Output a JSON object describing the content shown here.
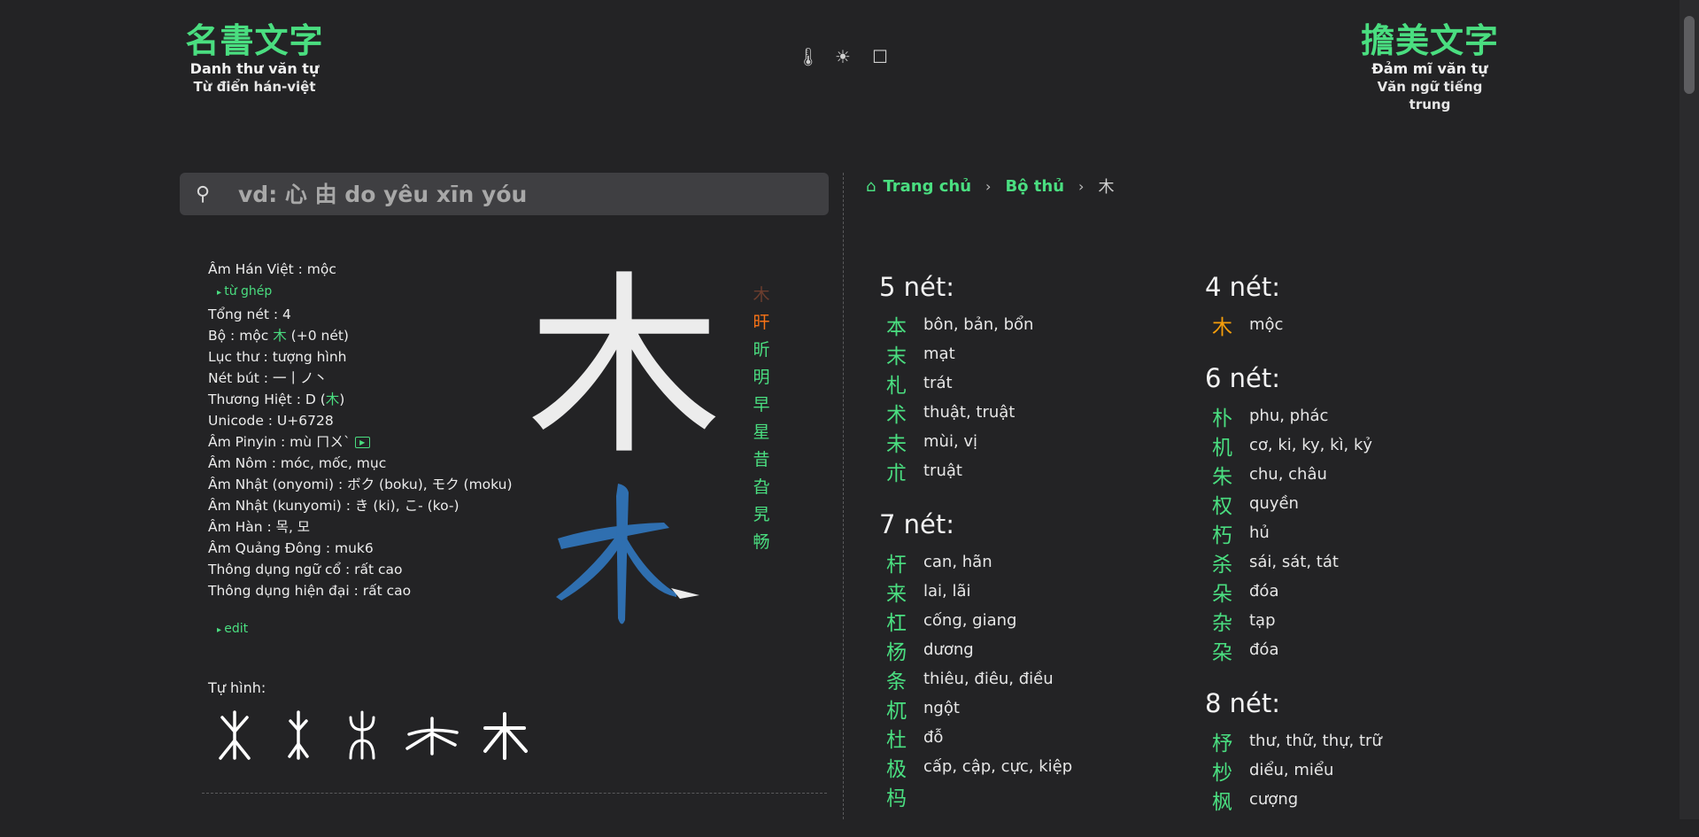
{
  "header": {
    "left": {
      "logo": "名書文字",
      "sub1": "Danh thư văn tự",
      "sub2": "Từ điển hán-việt"
    },
    "right": {
      "logo": "擔美文字",
      "sub1": "Đảm mĩ văn tự",
      "sub2": "Văn ngữ tiếng trung"
    },
    "icons": {
      "thermometer": "🌡",
      "sun": "☀",
      "square": "☐"
    }
  },
  "search": {
    "placeholder": "vd: 心 由 do yêu xīn yóu",
    "icon": "⚲"
  },
  "info": {
    "am_han_viet": "Âm Hán Việt : mộc",
    "tu_ghep": "từ ghép",
    "tong_net": "Tổng nét : 4",
    "bo_prefix": "Bộ : mộc ",
    "bo_char": "木",
    "bo_suffix": " (+0 nét)",
    "luc_thu": "Lục thư : tượng hình",
    "net_but": "Nét bút : 一丨ノ丶",
    "thuong_hiet_prefix": "Thương Hiệt : D (",
    "thuong_hiet_char": "木",
    "thuong_hiet_suffix": ")",
    "unicode": "Unicode : U+6728",
    "am_pinyin": "Âm Pinyin : mù ㄇㄨˋ",
    "play": "▶",
    "am_nom": "Âm Nôm : móc, mốc, mục",
    "am_nhat_on": "Âm Nhật (onyomi) : ボク (boku), モク (moku)",
    "am_nhat_kun": "Âm Nhật (kunyomi) : き (ki), こ- (ko-)",
    "am_han": "Âm Hàn : 목, 모",
    "am_quang_dong": "Âm Quảng Đông : muk6",
    "thong_dung_co": "Thông dụng ngữ cổ : rất cao",
    "thong_dung_hien": "Thông dụng hiện đại : rất cao",
    "edit": "edit",
    "tu_hinh": "Tự hình:"
  },
  "main_char": "木",
  "related": [
    "木",
    "旰",
    "昕",
    "明",
    "早",
    "星",
    "昔",
    "旮",
    "旯",
    "畅"
  ],
  "breadcrumb": {
    "home": "Trang chủ",
    "section": "Bộ thủ",
    "current": "木"
  },
  "groups_left": [
    {
      "title": "5 nét:",
      "items": [
        {
          "char": "本",
          "reading": "bôn, bản, bổn"
        },
        {
          "char": "末",
          "reading": "mạt"
        },
        {
          "char": "札",
          "reading": "trát"
        },
        {
          "char": "术",
          "reading": "thuật, truật"
        },
        {
          "char": "未",
          "reading": "mùi, vị"
        },
        {
          "char": "朮",
          "reading": "truật"
        }
      ]
    },
    {
      "title": "7 nét:",
      "items": [
        {
          "char": "杆",
          "reading": "can, hãn"
        },
        {
          "char": "来",
          "reading": "lai, lãi"
        },
        {
          "char": "杠",
          "reading": "cống, giang"
        },
        {
          "char": "杨",
          "reading": "dương"
        },
        {
          "char": "条",
          "reading": "thiêu, điêu, điều"
        },
        {
          "char": "杌",
          "reading": "ngột"
        },
        {
          "char": "杜",
          "reading": "đỗ"
        },
        {
          "char": "极",
          "reading": "cấp, cập, cực, kiệp"
        },
        {
          "char": "杩",
          "reading": ""
        }
      ]
    }
  ],
  "groups_right": [
    {
      "title": "4 nét:",
      "items": [
        {
          "char": "木",
          "reading": "mộc",
          "highlight": true
        }
      ]
    },
    {
      "title": "6 nét:",
      "items": [
        {
          "char": "朴",
          "reading": "phu, phác"
        },
        {
          "char": "机",
          "reading": "cơ, ki, ky, kì, kỷ"
        },
        {
          "char": "朱",
          "reading": "chu, châu"
        },
        {
          "char": "权",
          "reading": "quyền"
        },
        {
          "char": "朽",
          "reading": "hủ"
        },
        {
          "char": "杀",
          "reading": "sái, sát, tát"
        },
        {
          "char": "朵",
          "reading": "đóa"
        },
        {
          "char": "杂",
          "reading": "tạp"
        },
        {
          "char": "朶",
          "reading": "đóa"
        }
      ]
    },
    {
      "title": "8 nét:",
      "items": [
        {
          "char": "杼",
          "reading": "thư, thữ, thự, trữ"
        },
        {
          "char": "杪",
          "reading": "diểu, miểu"
        },
        {
          "char": "枫",
          "reading": "cượng"
        }
      ]
    }
  ],
  "colors": {
    "accent": "#4ade80",
    "orange": "#f59e0b",
    "stroke_blue": "#2f6fb0",
    "background": "#232325"
  }
}
